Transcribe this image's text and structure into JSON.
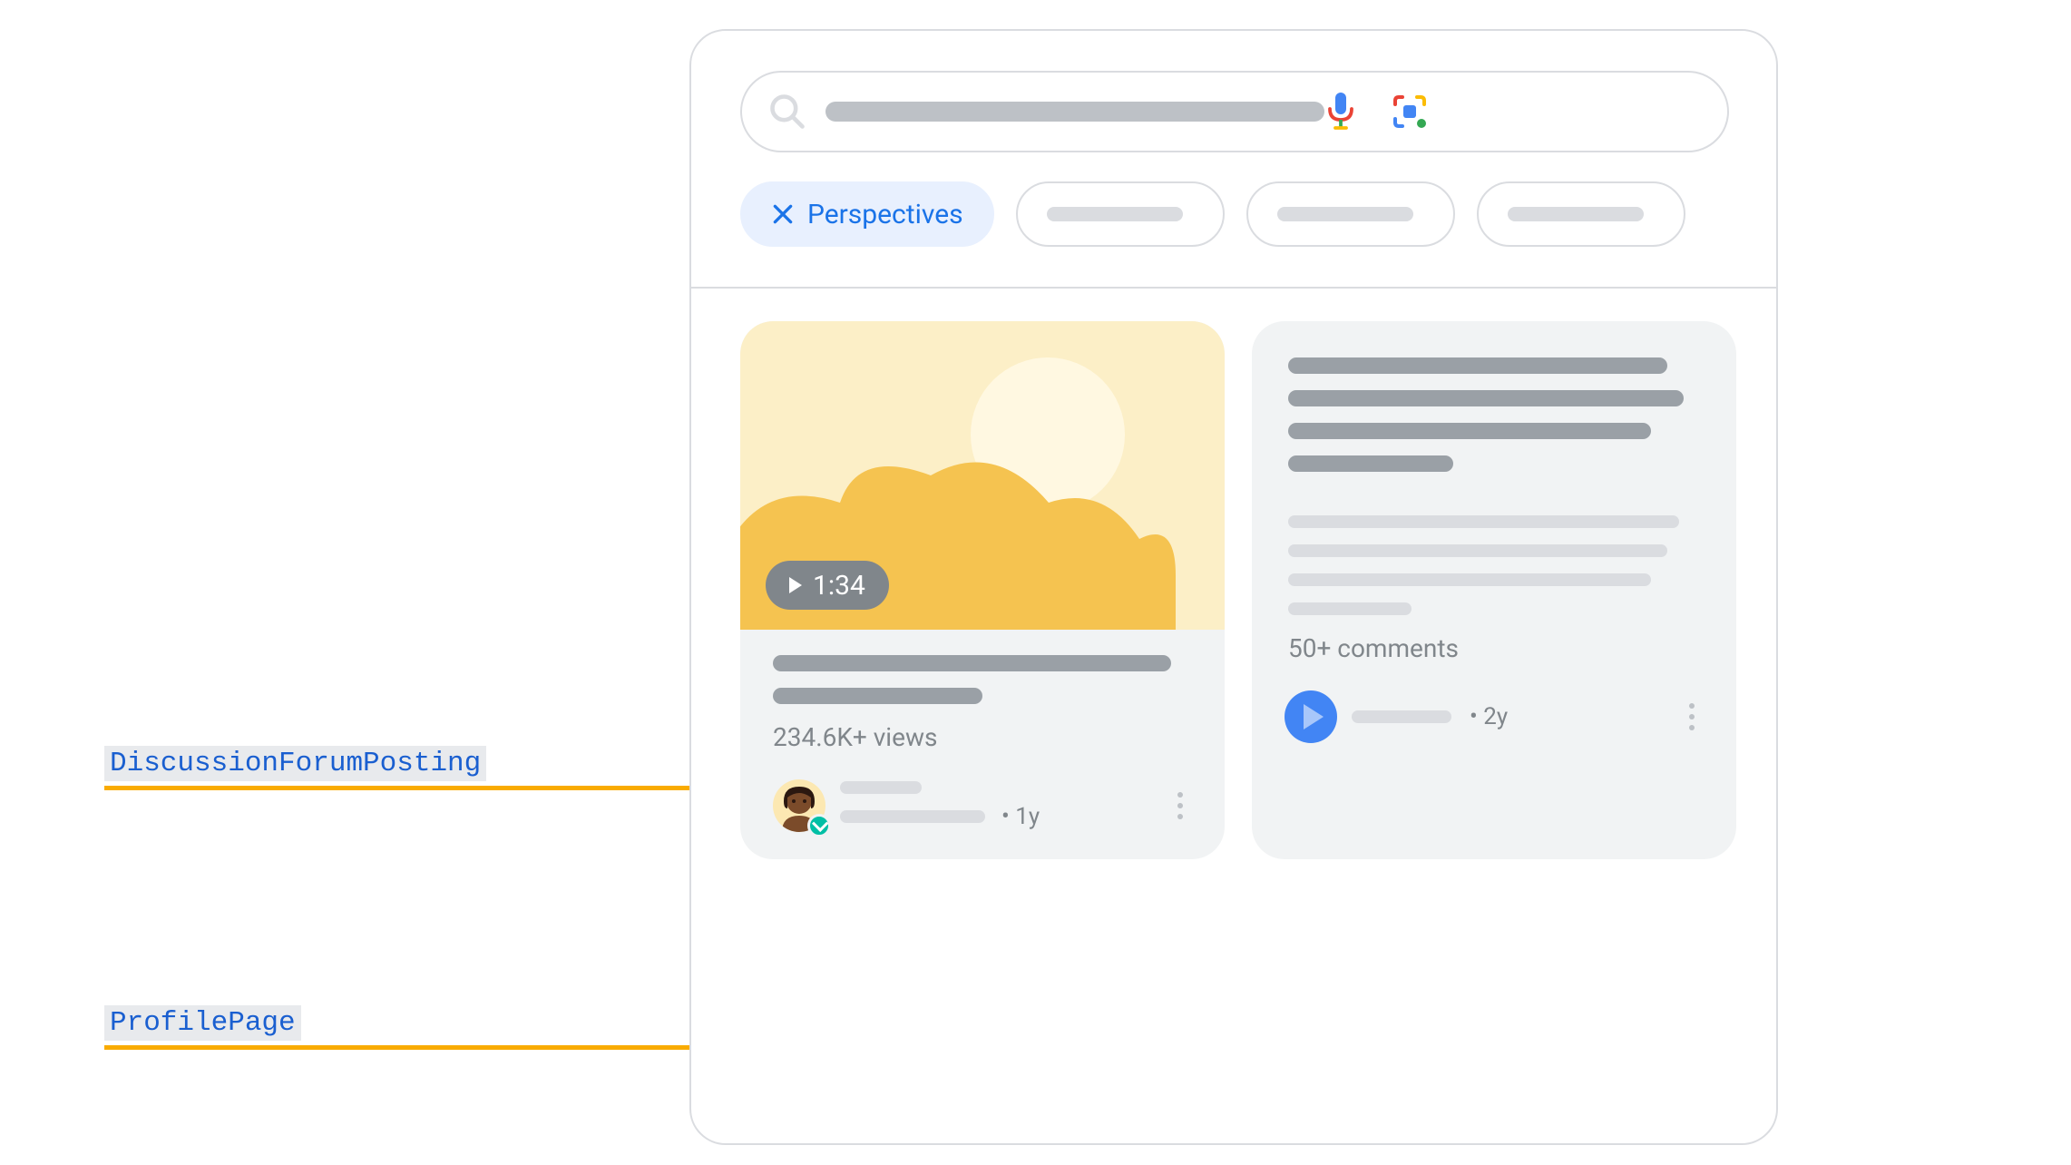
{
  "annotations": {
    "discussion_forum": "DiscussionForumPosting",
    "profile_page": "ProfilePage"
  },
  "search": {
    "placeholder": ""
  },
  "chips": {
    "active_label": "Perspectives"
  },
  "card1": {
    "duration": "1:34",
    "views": "234.6K+ views",
    "age": "1y"
  },
  "card2": {
    "comments": "50+ comments",
    "age": "2y"
  }
}
